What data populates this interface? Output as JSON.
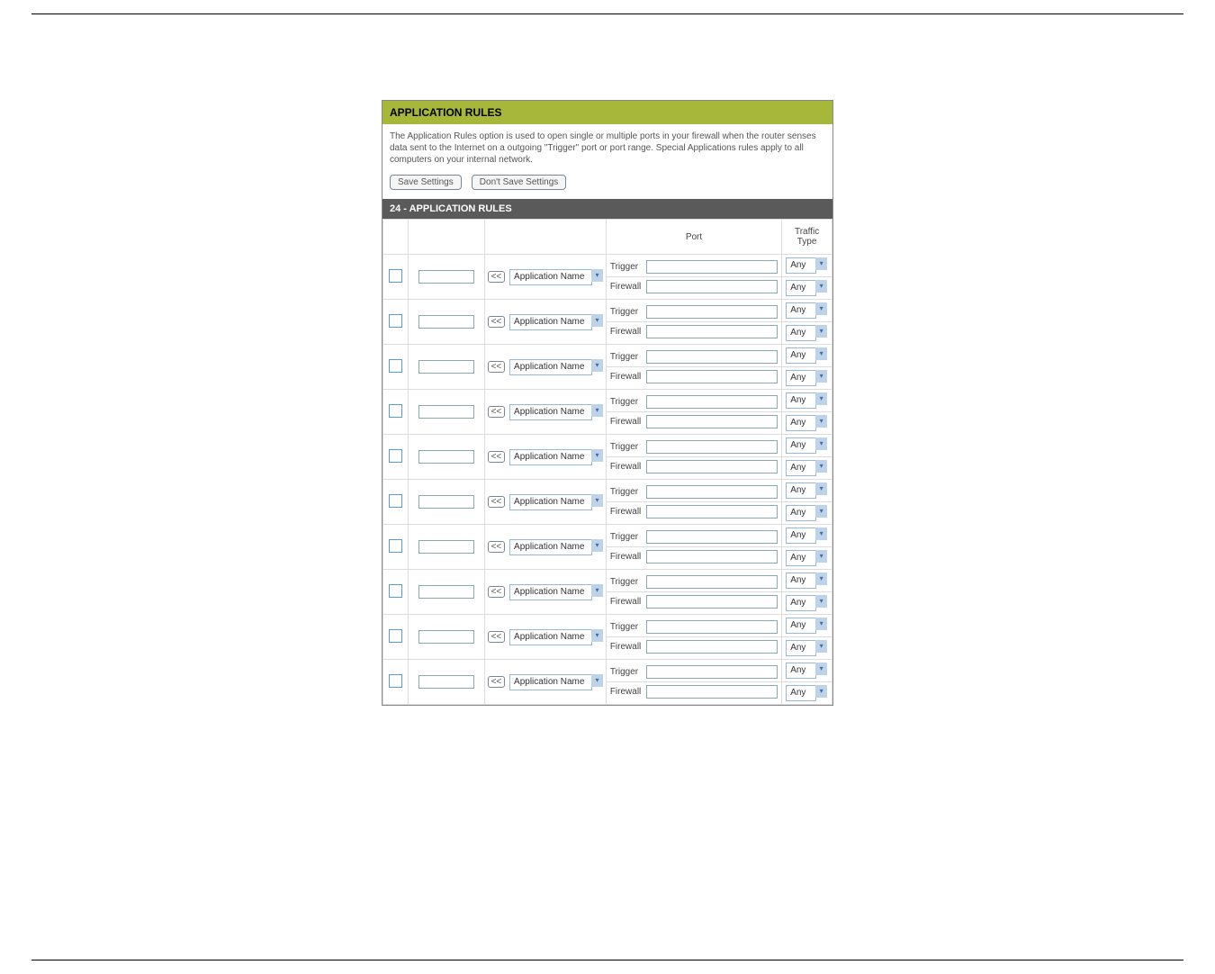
{
  "headerBox": {
    "title": "APPLICATION RULES",
    "intro": "The Application Rules option is used to open single or multiple ports in your firewall when the router senses data sent to the Internet on a outgoing \"Trigger\" port or port range. Special Applications rules apply to all computers on your internal network.",
    "saveBtn": "Save Settings",
    "dontSaveBtn": "Don't Save Settings"
  },
  "section": {
    "title": "24 - APPLICATION RULES",
    "cols": {
      "port": "Port",
      "traffic": "Traffic Type"
    },
    "labels": {
      "trigger": "Trigger",
      "firewall": "Firewall"
    },
    "copyBtn": "<<",
    "appSelect": "Application Name",
    "trafficSelect": "Any"
  },
  "chevron": "▾",
  "rows": 10
}
